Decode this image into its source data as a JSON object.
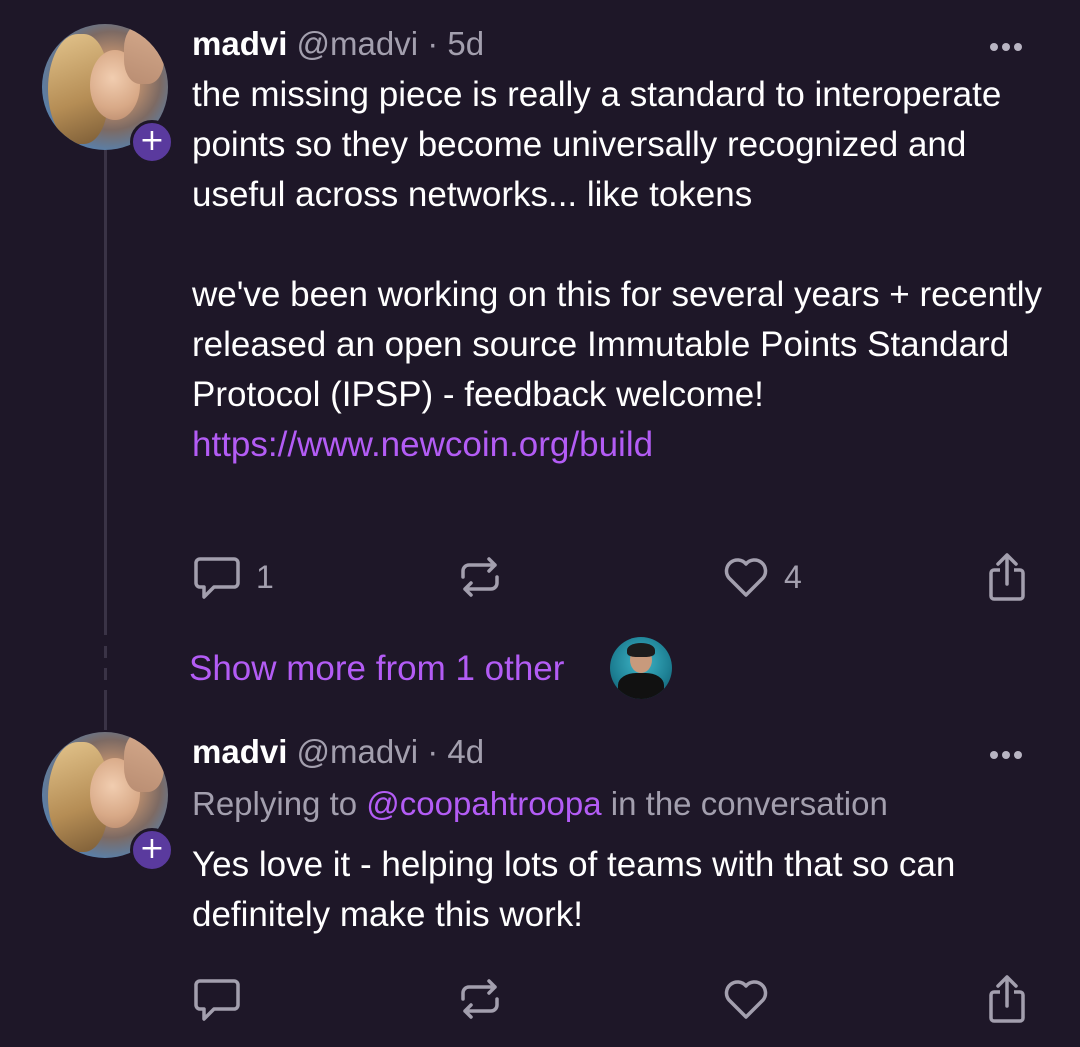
{
  "posts": [
    {
      "author_name": "madvi",
      "handle": "@madvi",
      "separator": "·",
      "time": "5d",
      "paragraphs": [
        "the missing piece is really a standard to interoperate points so they become universally recognized and useful across networks... like tokens",
        "we've been working on this for several years + recently released an open source Immutable Points Standard Protocol (IPSP) - feedback welcome!"
      ],
      "link_text": "https://www.newcoin.org/build",
      "reply_count": "1",
      "like_count": "4"
    },
    {
      "author_name": "madvi",
      "handle": "@madvi",
      "separator": "·",
      "time": "4d",
      "replying_prefix": "Replying to",
      "replying_mention": "@coopahtroopa",
      "replying_suffix": "in the conversation",
      "body": "Yes love it - helping lots of teams with that so can definitely make this work!"
    }
  ],
  "show_more": {
    "label": "Show more from 1 other"
  },
  "icons": {
    "more": "more-horizontal-icon",
    "reply": "reply-bubble-icon",
    "repost": "repost-icon",
    "like": "heart-icon",
    "share": "share-icon",
    "follow": "plus-icon"
  },
  "colors": {
    "background": "#1e1728",
    "accent": "#b35cf5",
    "muted": "#a39fae",
    "badge": "#5a3a9e"
  }
}
